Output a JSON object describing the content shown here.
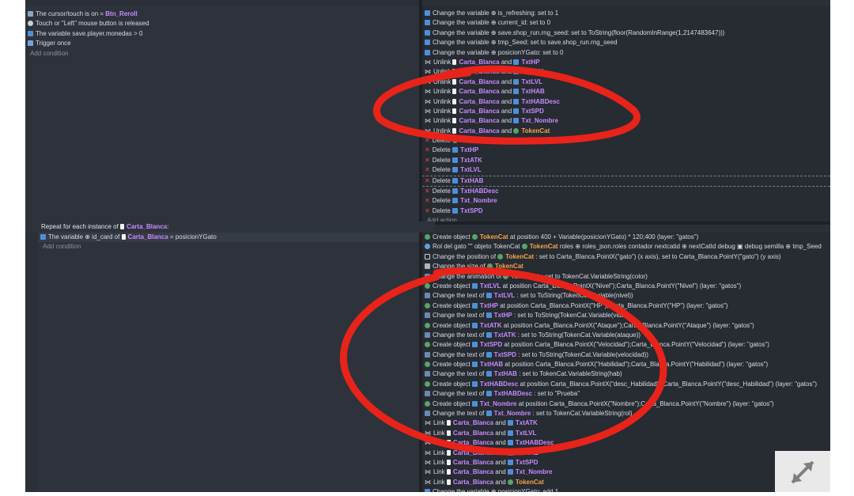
{
  "event1": {
    "conditions": [
      {
        "icon": "cursor-icon",
        "text": "The cursor/touch is on",
        "obj": "Btn_Reroll"
      },
      {
        "icon": "touch-icon",
        "text": "Touch or \"Left\" mouse button is released"
      },
      {
        "icon": "variable-icon",
        "text": "The variable",
        "var": "save.player.monedas",
        "rest": "> 0"
      },
      {
        "icon": "trigger-once-icon",
        "text": "Trigger once"
      }
    ],
    "add_condition": "Add condition",
    "actions": [
      "Change the variable ⊕ is_refreshing: set to 1",
      "Change the variable ⊕ current_id: set to 0",
      "Change the variable ⊕ save.shop_run.rng_seed: set to ToString(floor(RandomInRange(1,2147483647)))",
      "Change the variable ⊕ tmp_Seed: set to save.shop_run.rng_seed",
      "Change the variable ⊕ posicionYGato: set to 0"
    ],
    "unlinks": [
      {
        "a": "Carta_Blanca",
        "b": "TxtHP"
      },
      {
        "a": "Carta_Blanca",
        "b": "TxtATK"
      },
      {
        "a": "Carta_Blanca",
        "b": "TxtLVL"
      },
      {
        "a": "Carta_Blanca",
        "b": "TxtHAB"
      },
      {
        "a": "Carta_Blanca",
        "b": "TxtHABDesc"
      },
      {
        "a": "Carta_Blanca",
        "b": "TxtSPD"
      },
      {
        "a": "Carta_Blanca",
        "b": "Txt_Nombre"
      },
      {
        "a": "Carta_Blanca",
        "b": "TokenCat"
      }
    ],
    "unlink_label": "Unlink",
    "and_label": "and",
    "delete_label": "Delete",
    "deletes": [
      "TokenCat",
      "TxtHP",
      "TxtATK",
      "TxtLVL",
      "TxtHAB",
      "TxtHABDesc",
      "Txt_Nombre",
      "TxtSPD"
    ],
    "add_action": "Add action"
  },
  "event2": {
    "repeat_text": "Repeat for each instance of",
    "repeat_obj": "Carta_Blanca",
    "condition_text": "The variable ⊕ id_card of",
    "condition_obj": "Carta_Blanca",
    "condition_rest": "= posicionYGato",
    "add_condition": "Add condition",
    "actions": [
      {
        "icon": "create",
        "pre": "Create object",
        "obj": "TokenCat",
        "rest": "at position 400 + Variable(posicionYGato) * 120;400 (layer: \"gatos\")"
      },
      {
        "icon": "rol",
        "pre": "Rol del gato \"\" objeto TokenCat",
        "obj": "TokenCat",
        "rest": "roles ⊕ roles_json.roles contador nextcatid ⊕ nextCatId debug ▣ debug semilla ⊕ tmp_Seed"
      },
      {
        "icon": "pos",
        "pre": "Change the position of",
        "obj": "TokenCat",
        "rest": ": set to Carta_Blanca.PointX(\"gato\") (x axis), set to Carta_Blanca.PointY(\"gato\") (y axis)"
      },
      {
        "icon": "size",
        "pre": "Change the size of",
        "obj": "TokenCat",
        "rest": ""
      },
      {
        "icon": "text",
        "pre": "Change the animation of",
        "obj": "TokenCat",
        "rest": ": set to TokenCat.VariableString(color)"
      },
      {
        "icon": "create",
        "pre": "Create object",
        "obj": "TxtLVL",
        "rest": "at position Carta_Blanca.PointX(\"Nivel\");Carta_Blanca.PointY(\"Nivel\") (layer: \"gatos\")"
      },
      {
        "icon": "text",
        "pre": "Change the text of",
        "obj": "TxtLVL",
        "rest": ": set to ToString(TokenCat.Variable(nivel))"
      },
      {
        "icon": "create",
        "pre": "Create object",
        "obj": "TxtHP",
        "rest": "at position Carta_Blanca.PointX(\"HP\");Carta_Blanca.PointY(\"HP\") (layer: \"gatos\")"
      },
      {
        "icon": "text",
        "pre": "Change the text of",
        "obj": "TxtHP",
        "rest": ": set to ToString(TokenCat.Variable(vida))"
      },
      {
        "icon": "create",
        "pre": "Create object",
        "obj": "TxtATK",
        "rest": "at position Carta_Blanca.PointX(\"Ataque\");Carta_Blanca.PointY(\"Ataque\") (layer: \"gatos\")"
      },
      {
        "icon": "text",
        "pre": "Change the text of",
        "obj": "TxtATK",
        "rest": ": set to ToString(TokenCat.Variable(ataque))"
      },
      {
        "icon": "create",
        "pre": "Create object",
        "obj": "TxtSPD",
        "rest": "at position Carta_Blanca.PointX(\"Velocidad\");Carta_Blanca.PointY(\"Velocidad\") (layer: \"gatos\")"
      },
      {
        "icon": "text",
        "pre": "Change the text of",
        "obj": "TxtSPD",
        "rest": ": set to ToString(TokenCat.Variable(velocidad))"
      },
      {
        "icon": "create",
        "pre": "Create object",
        "obj": "TxtHAB",
        "rest": "at position Carta_Blanca.PointX(\"Habilidad\");Carta_Blanca.PointY(\"Habilidad\") (layer: \"gatos\")"
      },
      {
        "icon": "text",
        "pre": "Change the text of",
        "obj": "TxtHAB",
        "rest": ": set to TokenCat.VariableString(hab)"
      },
      {
        "icon": "create",
        "pre": "Create object",
        "obj": "TxtHABDesc",
        "rest": "at position Carta_Blanca.PointX(\"desc_Habilidad\");Carta_Blanca.PointY(\"desc_Habilidad\") (layer: \"gatos\")"
      },
      {
        "icon": "text",
        "pre": "Change the text of",
        "obj": "TxtHABDesc",
        "rest": ": set to \"Prueba\""
      },
      {
        "icon": "create",
        "pre": "Create object",
        "obj": "Txt_Nombre",
        "rest": "at position Carta_Blanca.PointX(\"Nombre\");Carta_Blanca.PointY(\"Nombre\") (layer: \"gatos\")"
      },
      {
        "icon": "text",
        "pre": "Change the text of",
        "obj": "Txt_Nombre",
        "rest": ": set to TokenCat.VariableString(rol)"
      }
    ],
    "links": [
      {
        "a": "Carta_Blanca",
        "b": "TxtATK"
      },
      {
        "a": "Carta_Blanca",
        "b": "TxtLVL"
      },
      {
        "a": "Carta_Blanca",
        "b": "TxtHABDesc"
      },
      {
        "a": "Carta_Blanca",
        "b": "TxtHAB"
      },
      {
        "a": "Carta_Blanca",
        "b": "TxtSPD"
      },
      {
        "a": "Carta_Blanca",
        "b": "Txt_Nombre"
      },
      {
        "a": "Carta_Blanca",
        "b": "TokenCat"
      }
    ],
    "link_label": "Link",
    "and_label": "and",
    "last_action": "Change the variable ⊕ posicionYGato: add 1"
  },
  "colors": {
    "annotation": "#e8231a",
    "object": "#c78bff",
    "token": "#f5a44a",
    "delete": "#e8453c"
  }
}
